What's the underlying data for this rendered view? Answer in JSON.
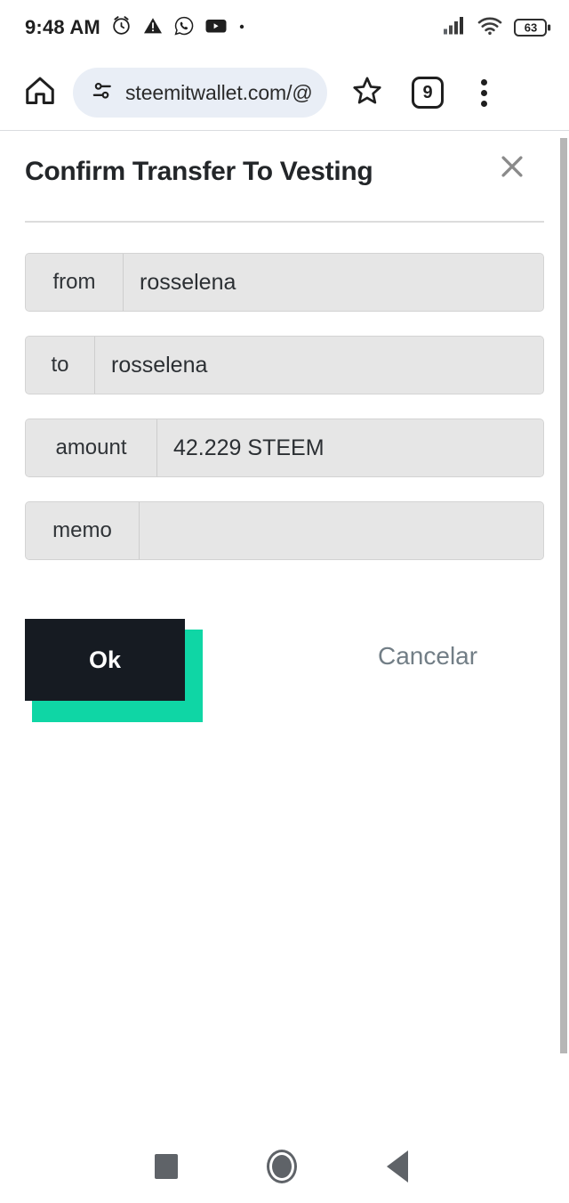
{
  "status_bar": {
    "time": "9:48 AM",
    "icons": [
      "alarm-clock-icon",
      "warning-triangle-icon",
      "whatsapp-icon",
      "youtube-icon",
      "overflow-dot-icon"
    ],
    "right_icons": [
      "cellular-signal-icon",
      "wifi-icon"
    ],
    "battery_level": "63"
  },
  "browser": {
    "home_label": "home-icon",
    "url": "steemitwallet.com/@",
    "site_settings_icon": "tune-icon",
    "bookmark_icon": "star-icon",
    "tab_count": "9",
    "menu_icon": "three-dot-menu-icon"
  },
  "dialog": {
    "title": "Confirm Transfer To Vesting",
    "close_icon": "close-icon",
    "fields": [
      {
        "label": "from",
        "value": "rosselena",
        "label_width": 110
      },
      {
        "label": "to",
        "value": "rosselena",
        "label_width": 78
      },
      {
        "label": "amount",
        "value": "42.229 STEEM",
        "label_width": 148
      },
      {
        "label": "memo",
        "value": "",
        "label_width": 128
      }
    ],
    "confirm_label": "Ok",
    "cancel_label": "Cancelar"
  },
  "colors": {
    "accent_teal": "#0fd6a5",
    "button_dark": "#161b22",
    "field_bg": "#e6e6e6",
    "cancel_text": "#727e86",
    "url_pill_bg": "#e9eef6"
  },
  "nav_bar": {
    "recents": "square-recents-icon",
    "home": "circle-home-icon",
    "back": "triangle-back-icon"
  }
}
